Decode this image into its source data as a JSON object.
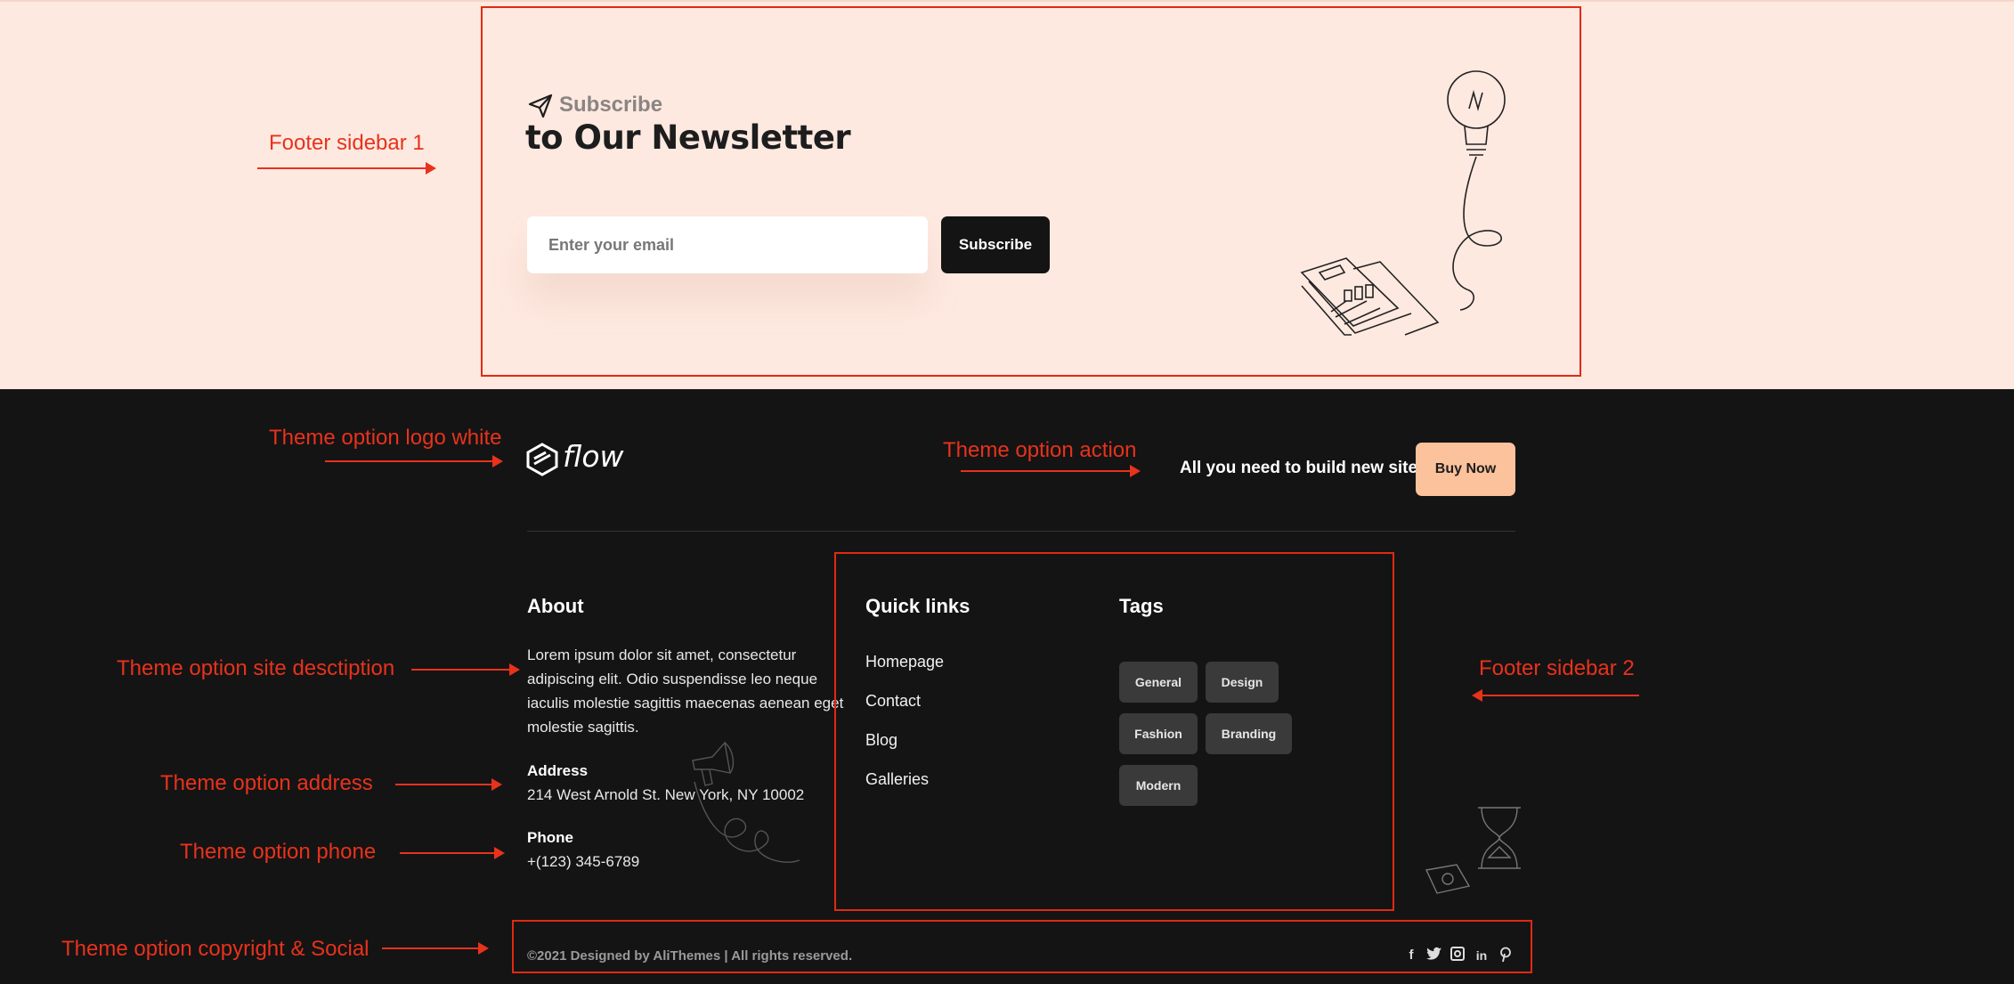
{
  "annotations": {
    "footer_sidebar_1": "Footer sidebar 1",
    "logo_white": "Theme option logo white",
    "action": "Theme option action",
    "site_description": "Theme option site desctiption",
    "address": "Theme option address",
    "phone": "Theme option phone",
    "copyright_social": "Theme option copyright & Social",
    "footer_sidebar_2": "Footer sidebar 2"
  },
  "newsletter": {
    "eyebrow": "Subscribe",
    "title": "to Our Newsletter",
    "email_placeholder": "Enter your email",
    "subscribe_label": "Subscribe"
  },
  "brand": {
    "logo_text": "flow"
  },
  "action": {
    "text": "All you need to build new site",
    "button_label": "Buy Now"
  },
  "about": {
    "heading": "About",
    "description_lines": [
      "Lorem ipsum dolor sit amet, consectetur",
      "adipiscing elit. Odio suspendisse leo neque",
      "iaculis molestie sagittis maecenas aenean eget",
      "molestie sagittis."
    ],
    "address_label": "Address",
    "address": "214 West Arnold St. New York, NY 10002",
    "phone_label": "Phone",
    "phone": "+(123) 345-6789"
  },
  "quick_links": {
    "heading": "Quick links",
    "items": [
      "Homepage",
      "Contact",
      "Blog",
      "Galleries"
    ]
  },
  "tags": {
    "heading": "Tags",
    "items": [
      "General",
      "Design",
      "Fashion",
      "Branding",
      "Modern"
    ]
  },
  "copyright": "©2021 Designed by AliThemes | All rights reserved.",
  "social_icons": [
    "facebook-icon",
    "twitter-icon",
    "instagram-icon",
    "linkedin-icon",
    "pinterest-icon"
  ],
  "colors": {
    "accent_red": "#e8321c",
    "cream": "#fee9e0",
    "dark": "#141414",
    "buy_button": "#fcc29c"
  }
}
